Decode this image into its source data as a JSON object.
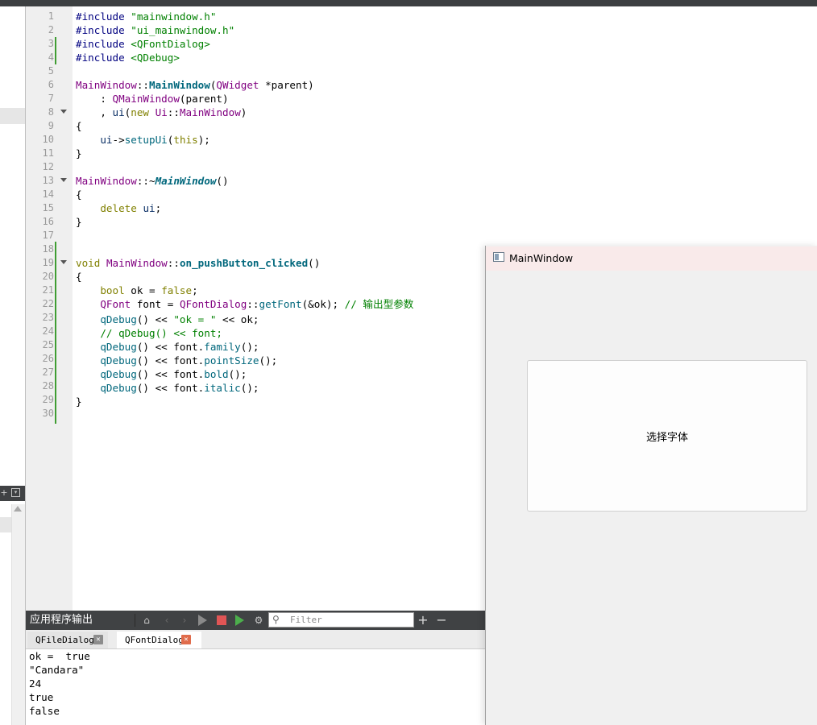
{
  "editor": {
    "line_numbers": [
      "1",
      "2",
      "3",
      "4",
      "5",
      "6",
      "7",
      "8",
      "9",
      "10",
      "11",
      "12",
      "13",
      "14",
      "15",
      "16",
      "17",
      "18",
      "19",
      "20",
      "21",
      "22",
      "23",
      "24",
      "25",
      "26",
      "27",
      "28",
      "29",
      "30"
    ]
  },
  "output_pane": {
    "title": "应用程序输出",
    "filter_placeholder": "Filter",
    "add_label": "+",
    "remove_label": "−",
    "tabs": [
      "QFileDialog",
      "QFontDialog"
    ],
    "active_tab": "QFontDialog",
    "lines": [
      "ok =  true",
      "\"Candara\"",
      "24",
      "true",
      "false"
    ]
  },
  "main_window": {
    "title": "MainWindow",
    "button_label": "选择字体"
  },
  "colors": {
    "keyword": "#808000",
    "string": "#008000",
    "class": "#800080",
    "function": "#00677c",
    "modified_bar": "#3f9d33",
    "stop": "#e05555"
  }
}
